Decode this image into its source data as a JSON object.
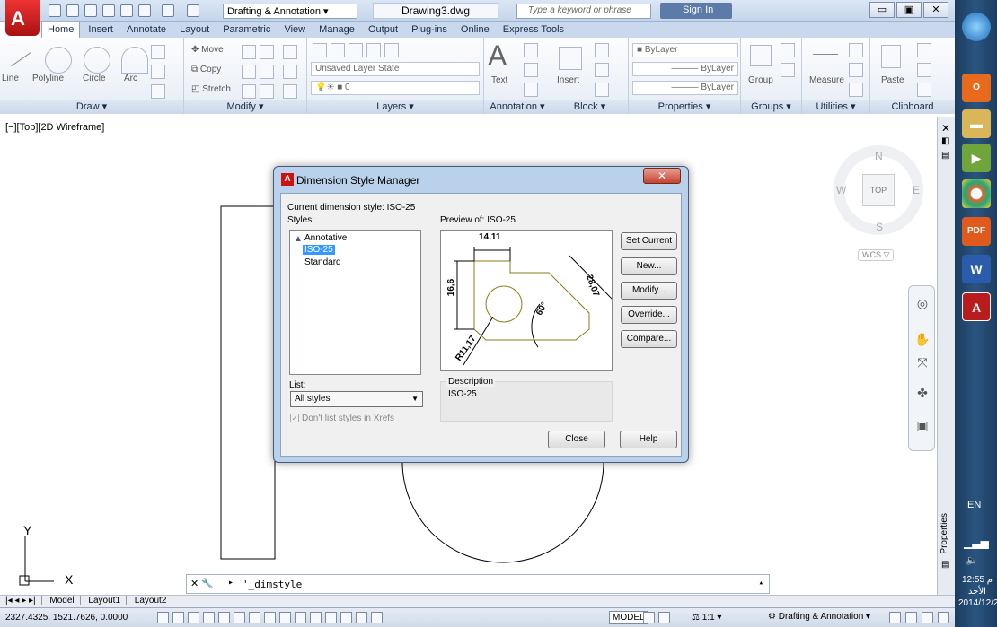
{
  "title_bar": {
    "workspace": "Drafting & Annotation",
    "document": "Drawing3.dwg",
    "search_placeholder": "Type a keyword or phrase",
    "sign_in": "Sign In"
  },
  "ribbon": {
    "tabs": [
      "Home",
      "Insert",
      "Annotate",
      "Layout",
      "Parametric",
      "View",
      "Manage",
      "Output",
      "Plug-ins",
      "Online",
      "Express Tools"
    ],
    "active_tab": "Home",
    "draw": {
      "title": "Draw ▾",
      "tools": [
        "Line",
        "Polyline",
        "Circle",
        "Arc"
      ]
    },
    "modify": {
      "title": "Modify ▾",
      "move": "Move",
      "copy": "Copy",
      "stretch": "Stretch"
    },
    "layers": {
      "title": "Layers ▾",
      "state": "Unsaved Layer State",
      "current": "0"
    },
    "annotation": {
      "title": "Annotation ▾",
      "text": "Text"
    },
    "block": {
      "title": "Block ▾",
      "insert": "Insert"
    },
    "properties": {
      "title": "Properties ▾",
      "color": "ByLayer",
      "linetype": "ByLayer",
      "lineweight": "ByLayer"
    },
    "groups": {
      "title": "Groups ▾",
      "group": "Group"
    },
    "utilities": {
      "title": "Utilities ▾",
      "measure": "Measure"
    },
    "clipboard": {
      "title": "Clipboard",
      "paste": "Paste"
    }
  },
  "viewport": {
    "label": "[−][Top][2D Wireframe]",
    "cube_top": "TOP",
    "north": "N",
    "south": "S",
    "east": "E",
    "west": "W",
    "wcs": "WCS ▽",
    "axis_x": "X",
    "axis_y": "Y"
  },
  "dialog": {
    "title": "Dimension Style Manager",
    "current_style": "Current dimension style: ISO-25",
    "styles_label": "Styles:",
    "styles": [
      "Annotative",
      "ISO-25",
      "Standard"
    ],
    "selected_style": "ISO-25",
    "preview_label": "Preview of: ISO-25",
    "preview_dims": {
      "d1": "14,11",
      "d2": "16,6",
      "d3": "28,07",
      "d4": "60°",
      "d5": "R11,17"
    },
    "buttons": [
      "Set Current",
      "New...",
      "Modify...",
      "Override...",
      "Compare..."
    ],
    "list_label": "List:",
    "list_value": "All styles",
    "xref_checkbox": "Don't list styles in Xrefs",
    "description_label": "Description",
    "description_value": "ISO-25",
    "close": "Close",
    "help": "Help"
  },
  "command_line": {
    "text": "'_dimstyle"
  },
  "layout_tabs": [
    "Model",
    "Layout1",
    "Layout2"
  ],
  "properties_palette": "Properties",
  "status_bar": {
    "coords": "2327.4325, 1521.7626, 0.0000",
    "model": "MODEL",
    "scale": "1:1 ▾",
    "workspace": "Drafting & Annotation ▾"
  },
  "taskbar": {
    "lang": "EN",
    "time": "12:55 م",
    "day": "الأحد",
    "date": "2014/12/2",
    "apps": [
      "PDF",
      "W"
    ]
  },
  "colors": {
    "accent": "#3399ff",
    "ribbon_bg": "#e6ecf5",
    "dialog_frame": "#b9d1ea",
    "taskbar": "#2a5580"
  }
}
